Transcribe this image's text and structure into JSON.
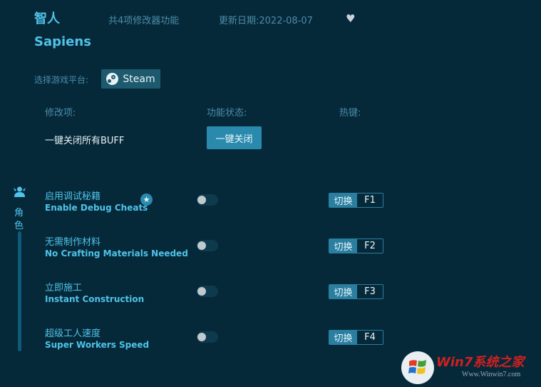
{
  "header": {
    "title_cn": "智人",
    "title_en": "Sapiens",
    "feature_count": "共4项修改器功能",
    "update_date": "更新日期:2022-08-07",
    "favorite_icon": "heart-icon"
  },
  "platform": {
    "label": "选择游戏平台:",
    "button_label": "Steam",
    "icon": "steam-icon"
  },
  "columns": {
    "option": "修改项:",
    "status": "功能状态:",
    "hotkey": "热键:"
  },
  "global": {
    "label": "一键关闭所有BUFF",
    "button_label": "一键关闭"
  },
  "category": {
    "char1": "角",
    "char2": "色",
    "icon": "character-icon"
  },
  "options": [
    {
      "name_cn": "启用调试秘籍",
      "name_en": "Enable Debug Cheats",
      "enabled": false,
      "hotkey_label": "切换",
      "key": "F1",
      "starred": true
    },
    {
      "name_cn": "无需制作材料",
      "name_en": "No Crafting Materials Needed",
      "enabled": false,
      "hotkey_label": "切换",
      "key": "F2"
    },
    {
      "name_cn": "立即施工",
      "name_en": "Instant Construction",
      "enabled": false,
      "hotkey_label": "切换",
      "key": "F3"
    },
    {
      "name_cn": "超级工人速度",
      "name_en": "Super Workers Speed",
      "enabled": false,
      "hotkey_label": "切换",
      "key": "F4"
    }
  ],
  "watermark": {
    "brand": "Win7系统之家",
    "url": "Www.Winwin7.com"
  },
  "colors": {
    "background": "#06293a",
    "accent": "#4fc3e8",
    "button": "#2a8aad"
  }
}
